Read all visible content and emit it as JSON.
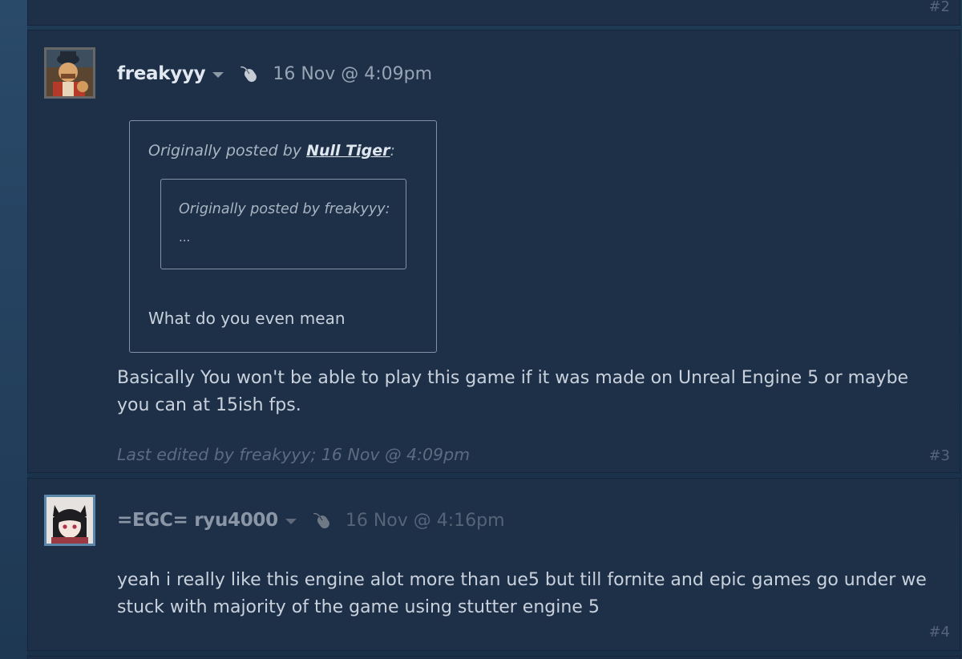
{
  "posts": [
    {
      "number": "#2"
    },
    {
      "number": "#3",
      "username": "freakyyy",
      "timestamp": "16 Nov @ 4:09pm",
      "quote": {
        "prefix": "Originally posted by ",
        "author": "Null Tiger",
        "suffix": ":",
        "inner_author_line": "Originally posted by freakyyy:",
        "inner_text": "...",
        "text": "What do you even mean"
      },
      "body": "Basically You won't be able to play this game if it was made on Unreal Engine 5 or maybe you can at 15ish fps.",
      "edited": "Last edited by freakyyy; 16 Nov @ 4:09pm"
    },
    {
      "number": "#4",
      "username": "=EGC= ryu4000",
      "timestamp": "16 Nov @ 4:16pm",
      "body": "yeah i really like this engine alot more than ue5 but till fornite and epic games go under we stuck with majority of the game using stutter engine 5"
    }
  ],
  "icons": {
    "mouse": "mouse-icon",
    "caret": "chevron-down-icon"
  },
  "colors": {
    "background": "#1c344e",
    "post_background": "#1e2f48",
    "text": "#c9d2dc",
    "username": "#e2e8ef"
  }
}
